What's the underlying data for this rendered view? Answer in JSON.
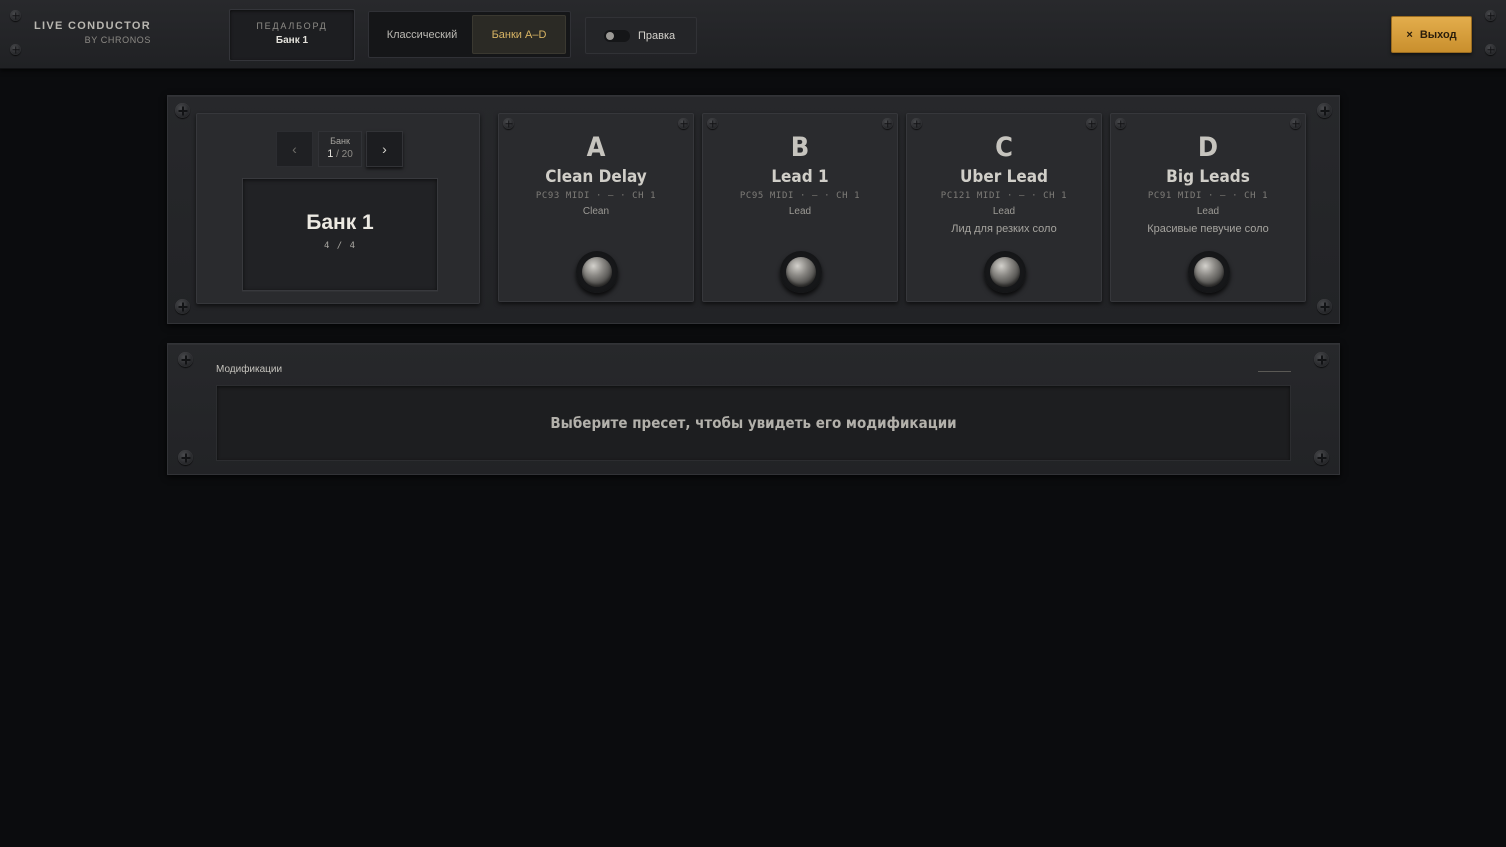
{
  "header": {
    "brand_title": "LIVE CONDUCTOR",
    "brand_sub": "BY CHRONOS",
    "pedalboard_label": "ПЕДАЛБОРД",
    "pedalboard_value": "Банк 1",
    "modes": [
      {
        "label": "Классический",
        "active": false
      },
      {
        "label": "Банки A–D",
        "active": true
      }
    ],
    "edit_label": "Правка",
    "edit_enabled": false,
    "exit_icon": "×",
    "exit_label": "Выход"
  },
  "bank_nav": {
    "prev_icon": "‹",
    "next_icon": "›",
    "counter_label": "Банк",
    "current": "1",
    "total_text": "/ 20",
    "display_title": "Банк 1",
    "display_count": "4 / 4"
  },
  "presets": [
    {
      "letter": "A",
      "name": "Clean Delay",
      "midi": "PC93 MIDI · — · CH 1",
      "tag": "Clean",
      "desc": ""
    },
    {
      "letter": "B",
      "name": "Lead 1",
      "midi": "PC95 MIDI · — · CH 1",
      "tag": "Lead",
      "desc": ""
    },
    {
      "letter": "C",
      "name": "Uber Lead",
      "midi": "PC121 MIDI · — · CH 1",
      "tag": "Lead",
      "desc": "Лид для резких соло"
    },
    {
      "letter": "D",
      "name": "Big Leads",
      "midi": "PC91 MIDI · — · CH 1",
      "tag": "Lead",
      "desc": "Красивые певучие соло"
    }
  ],
  "modifications": {
    "title": "Модификации",
    "empty_text": "Выберите пресет, чтобы увидеть его модификации"
  },
  "colors": {
    "accent": "#d8b464",
    "exit_button": "#d9a040",
    "background": "#0b0c0e"
  }
}
